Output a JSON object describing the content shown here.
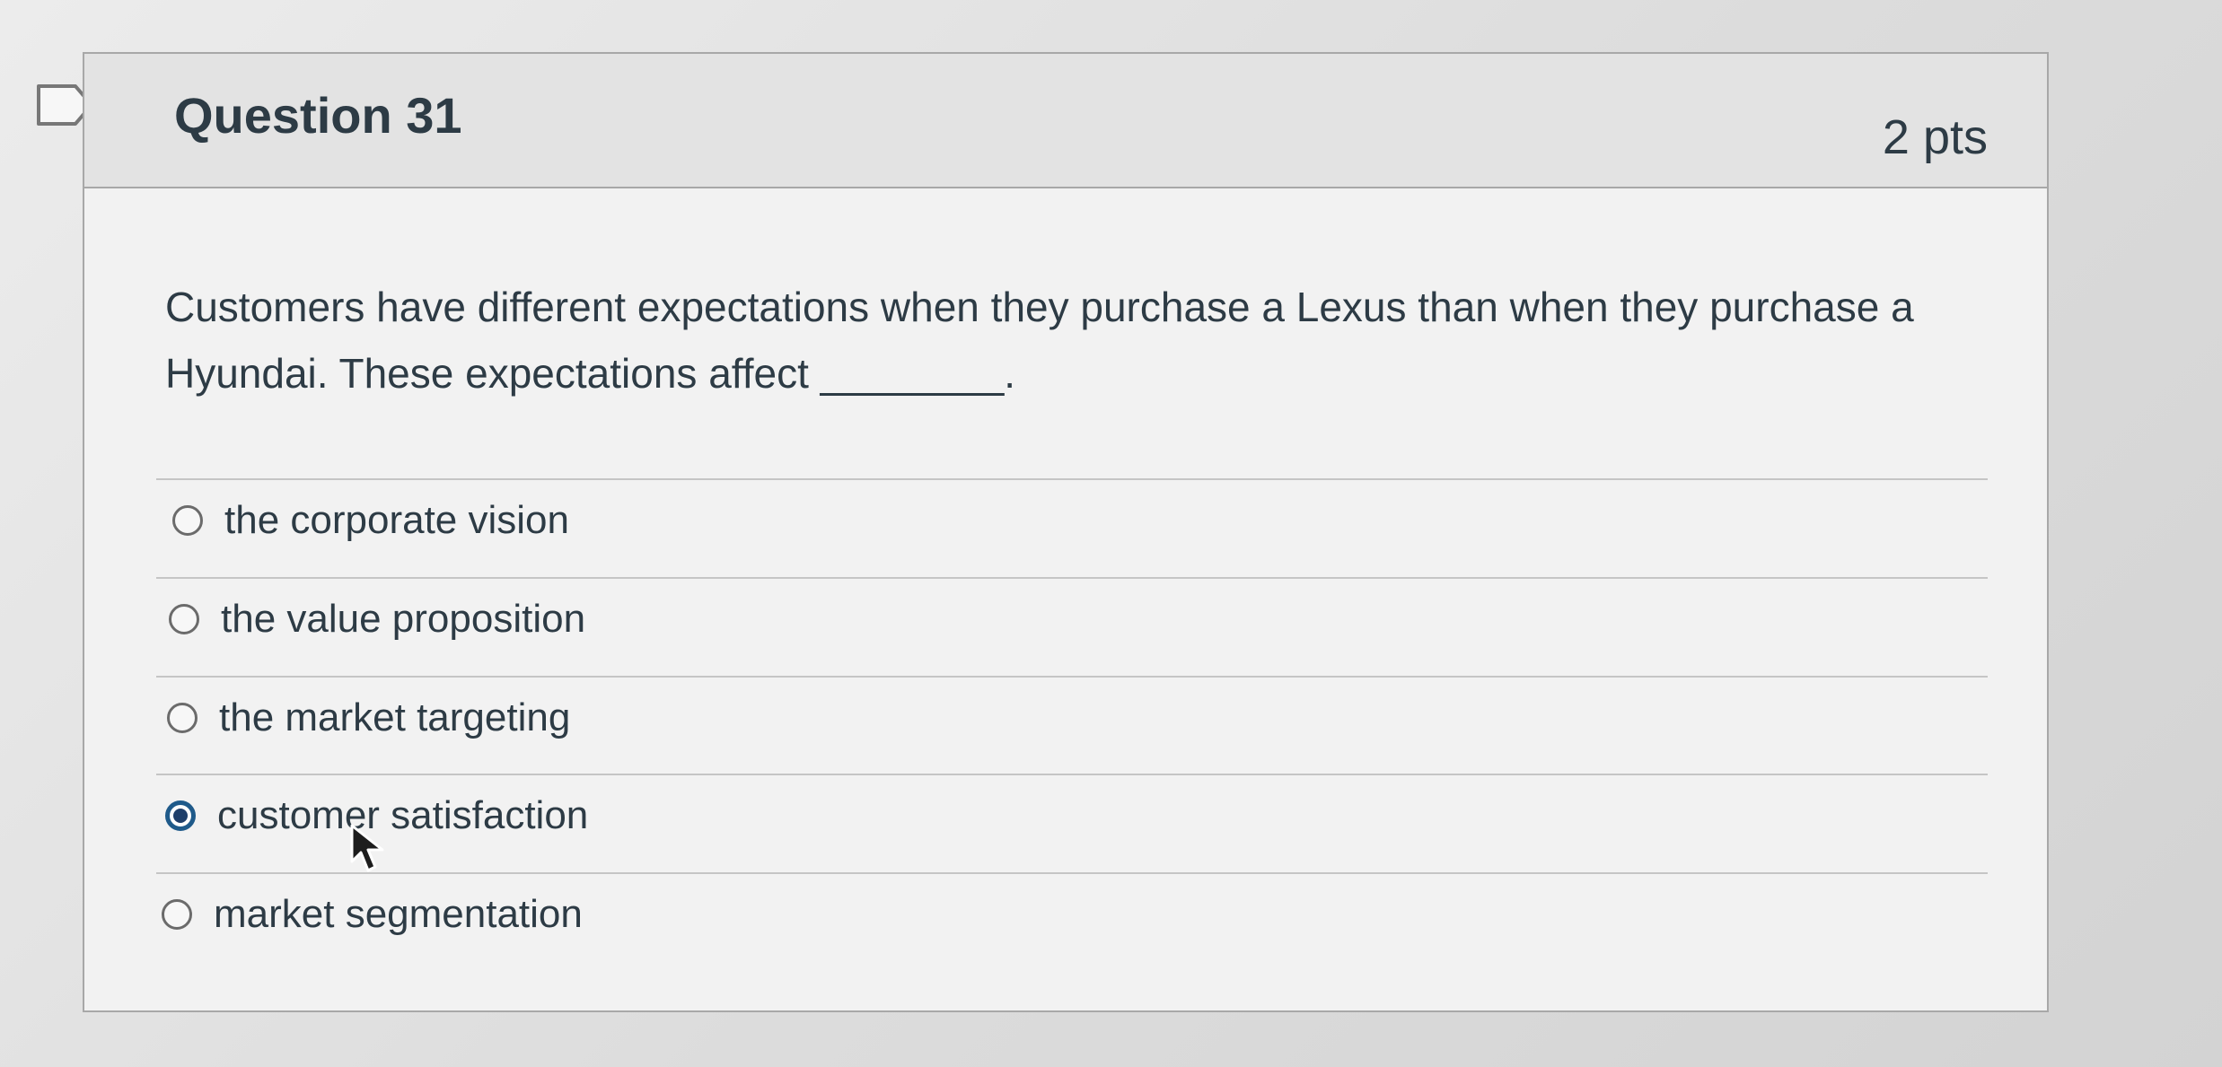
{
  "question": {
    "title": "Question 31",
    "points": "2 pts",
    "text": "Customers have different expectations when they purchase a Lexus than when they purchase a Hyundai. These expectations affect ________.",
    "options": [
      {
        "label": "the corporate vision",
        "selected": false
      },
      {
        "label": "the value proposition",
        "selected": false
      },
      {
        "label": "the market targeting",
        "selected": false
      },
      {
        "label": "customer satisfaction",
        "selected": true
      },
      {
        "label": "market segmentation",
        "selected": false
      }
    ]
  },
  "icons": {
    "flag": "flag-question-icon",
    "cursor": "mouse-pointer-icon",
    "radio_selected": "radio-selected-icon",
    "radio_unselected": "radio-unselected-icon"
  },
  "colors": {
    "text": "#2d3b45",
    "border": "#a8a8a8",
    "header_bg": "#e3e3e3",
    "card_bg": "#f2f2f2",
    "selected_radio": "#1f5a8a"
  }
}
